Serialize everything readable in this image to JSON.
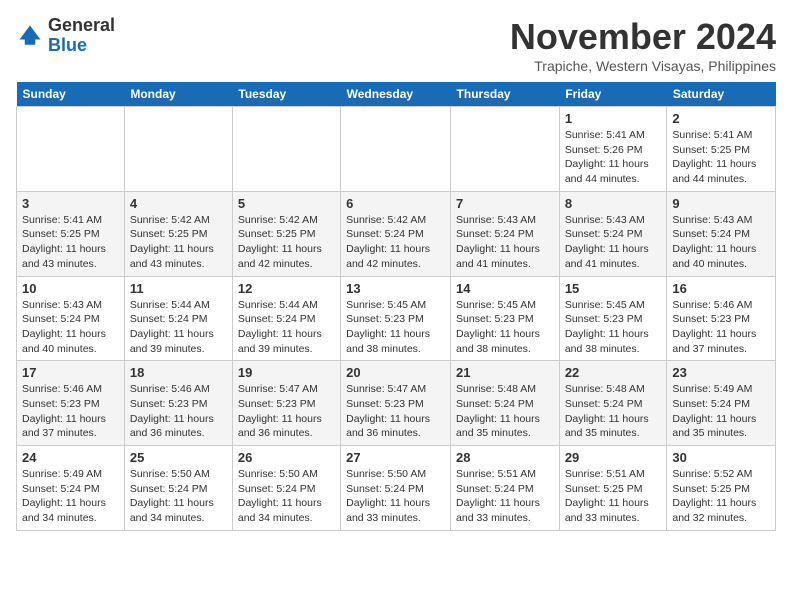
{
  "header": {
    "logo_general": "General",
    "logo_blue": "Blue",
    "month_title": "November 2024",
    "location": "Trapiche, Western Visayas, Philippines"
  },
  "weekdays": [
    "Sunday",
    "Monday",
    "Tuesday",
    "Wednesday",
    "Thursday",
    "Friday",
    "Saturday"
  ],
  "weeks": [
    [
      {
        "day": "",
        "detail": ""
      },
      {
        "day": "",
        "detail": ""
      },
      {
        "day": "",
        "detail": ""
      },
      {
        "day": "",
        "detail": ""
      },
      {
        "day": "",
        "detail": ""
      },
      {
        "day": "1",
        "detail": "Sunrise: 5:41 AM\nSunset: 5:26 PM\nDaylight: 11 hours and 44 minutes."
      },
      {
        "day": "2",
        "detail": "Sunrise: 5:41 AM\nSunset: 5:25 PM\nDaylight: 11 hours and 44 minutes."
      }
    ],
    [
      {
        "day": "3",
        "detail": "Sunrise: 5:41 AM\nSunset: 5:25 PM\nDaylight: 11 hours and 43 minutes."
      },
      {
        "day": "4",
        "detail": "Sunrise: 5:42 AM\nSunset: 5:25 PM\nDaylight: 11 hours and 43 minutes."
      },
      {
        "day": "5",
        "detail": "Sunrise: 5:42 AM\nSunset: 5:25 PM\nDaylight: 11 hours and 42 minutes."
      },
      {
        "day": "6",
        "detail": "Sunrise: 5:42 AM\nSunset: 5:24 PM\nDaylight: 11 hours and 42 minutes."
      },
      {
        "day": "7",
        "detail": "Sunrise: 5:43 AM\nSunset: 5:24 PM\nDaylight: 11 hours and 41 minutes."
      },
      {
        "day": "8",
        "detail": "Sunrise: 5:43 AM\nSunset: 5:24 PM\nDaylight: 11 hours and 41 minutes."
      },
      {
        "day": "9",
        "detail": "Sunrise: 5:43 AM\nSunset: 5:24 PM\nDaylight: 11 hours and 40 minutes."
      }
    ],
    [
      {
        "day": "10",
        "detail": "Sunrise: 5:43 AM\nSunset: 5:24 PM\nDaylight: 11 hours and 40 minutes."
      },
      {
        "day": "11",
        "detail": "Sunrise: 5:44 AM\nSunset: 5:24 PM\nDaylight: 11 hours and 39 minutes."
      },
      {
        "day": "12",
        "detail": "Sunrise: 5:44 AM\nSunset: 5:24 PM\nDaylight: 11 hours and 39 minutes."
      },
      {
        "day": "13",
        "detail": "Sunrise: 5:45 AM\nSunset: 5:23 PM\nDaylight: 11 hours and 38 minutes."
      },
      {
        "day": "14",
        "detail": "Sunrise: 5:45 AM\nSunset: 5:23 PM\nDaylight: 11 hours and 38 minutes."
      },
      {
        "day": "15",
        "detail": "Sunrise: 5:45 AM\nSunset: 5:23 PM\nDaylight: 11 hours and 38 minutes."
      },
      {
        "day": "16",
        "detail": "Sunrise: 5:46 AM\nSunset: 5:23 PM\nDaylight: 11 hours and 37 minutes."
      }
    ],
    [
      {
        "day": "17",
        "detail": "Sunrise: 5:46 AM\nSunset: 5:23 PM\nDaylight: 11 hours and 37 minutes."
      },
      {
        "day": "18",
        "detail": "Sunrise: 5:46 AM\nSunset: 5:23 PM\nDaylight: 11 hours and 36 minutes."
      },
      {
        "day": "19",
        "detail": "Sunrise: 5:47 AM\nSunset: 5:23 PM\nDaylight: 11 hours and 36 minutes."
      },
      {
        "day": "20",
        "detail": "Sunrise: 5:47 AM\nSunset: 5:23 PM\nDaylight: 11 hours and 36 minutes."
      },
      {
        "day": "21",
        "detail": "Sunrise: 5:48 AM\nSunset: 5:24 PM\nDaylight: 11 hours and 35 minutes."
      },
      {
        "day": "22",
        "detail": "Sunrise: 5:48 AM\nSunset: 5:24 PM\nDaylight: 11 hours and 35 minutes."
      },
      {
        "day": "23",
        "detail": "Sunrise: 5:49 AM\nSunset: 5:24 PM\nDaylight: 11 hours and 35 minutes."
      }
    ],
    [
      {
        "day": "24",
        "detail": "Sunrise: 5:49 AM\nSunset: 5:24 PM\nDaylight: 11 hours and 34 minutes."
      },
      {
        "day": "25",
        "detail": "Sunrise: 5:50 AM\nSunset: 5:24 PM\nDaylight: 11 hours and 34 minutes."
      },
      {
        "day": "26",
        "detail": "Sunrise: 5:50 AM\nSunset: 5:24 PM\nDaylight: 11 hours and 34 minutes."
      },
      {
        "day": "27",
        "detail": "Sunrise: 5:50 AM\nSunset: 5:24 PM\nDaylight: 11 hours and 33 minutes."
      },
      {
        "day": "28",
        "detail": "Sunrise: 5:51 AM\nSunset: 5:24 PM\nDaylight: 11 hours and 33 minutes."
      },
      {
        "day": "29",
        "detail": "Sunrise: 5:51 AM\nSunset: 5:25 PM\nDaylight: 11 hours and 33 minutes."
      },
      {
        "day": "30",
        "detail": "Sunrise: 5:52 AM\nSunset: 5:25 PM\nDaylight: 11 hours and 32 minutes."
      }
    ]
  ]
}
